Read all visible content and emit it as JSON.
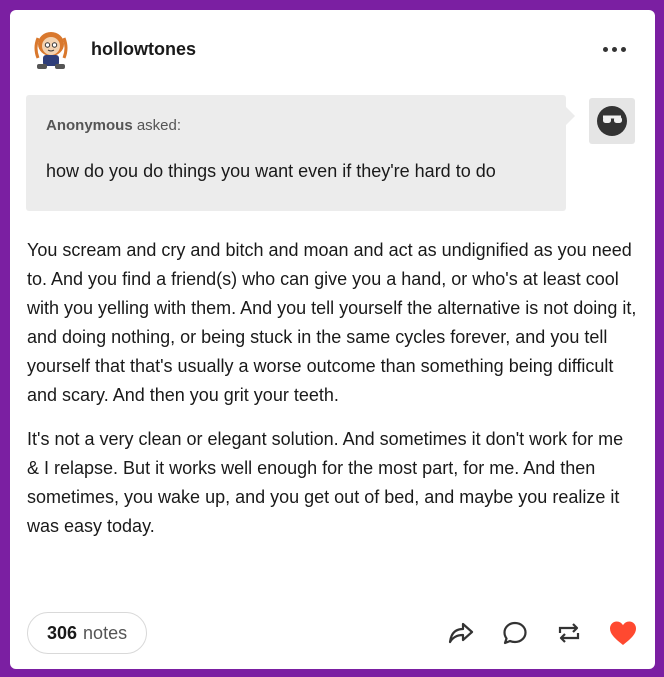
{
  "post": {
    "username": "hollowtones",
    "asker_name": "Anonymous",
    "asker_suffix": "asked:",
    "question": "how do you do things you want even if they're hard to do",
    "paragraphs": [
      "You scream and cry and bitch and moan and act as undignified as you need to. And you find a friend(s) who can give you a hand, or who's at least cool with you yelling with them. And you tell yourself the alternative is not doing it, and doing nothing, or being stuck in the same cycles forever, and you tell yourself that that's usually a worse outcome than something being difficult and scary. And then you grit your teeth.",
      "It's not a very clean or elegant solution. And sometimes it don't work for me & I relapse. But it works well enough for the most part, for me. And then sometimes, you wake up, and you get out of bed, and maybe you realize it was easy today."
    ]
  },
  "footer": {
    "notes_count": "306",
    "notes_label": "notes"
  },
  "icons": {
    "more": "more-options-icon",
    "share": "share-icon",
    "reply": "reply-icon",
    "reblog": "reblog-icon",
    "like": "heart-icon"
  },
  "colors": {
    "background": "#7b1fa2",
    "like": "#ff4930",
    "ask_box": "#ececec"
  }
}
